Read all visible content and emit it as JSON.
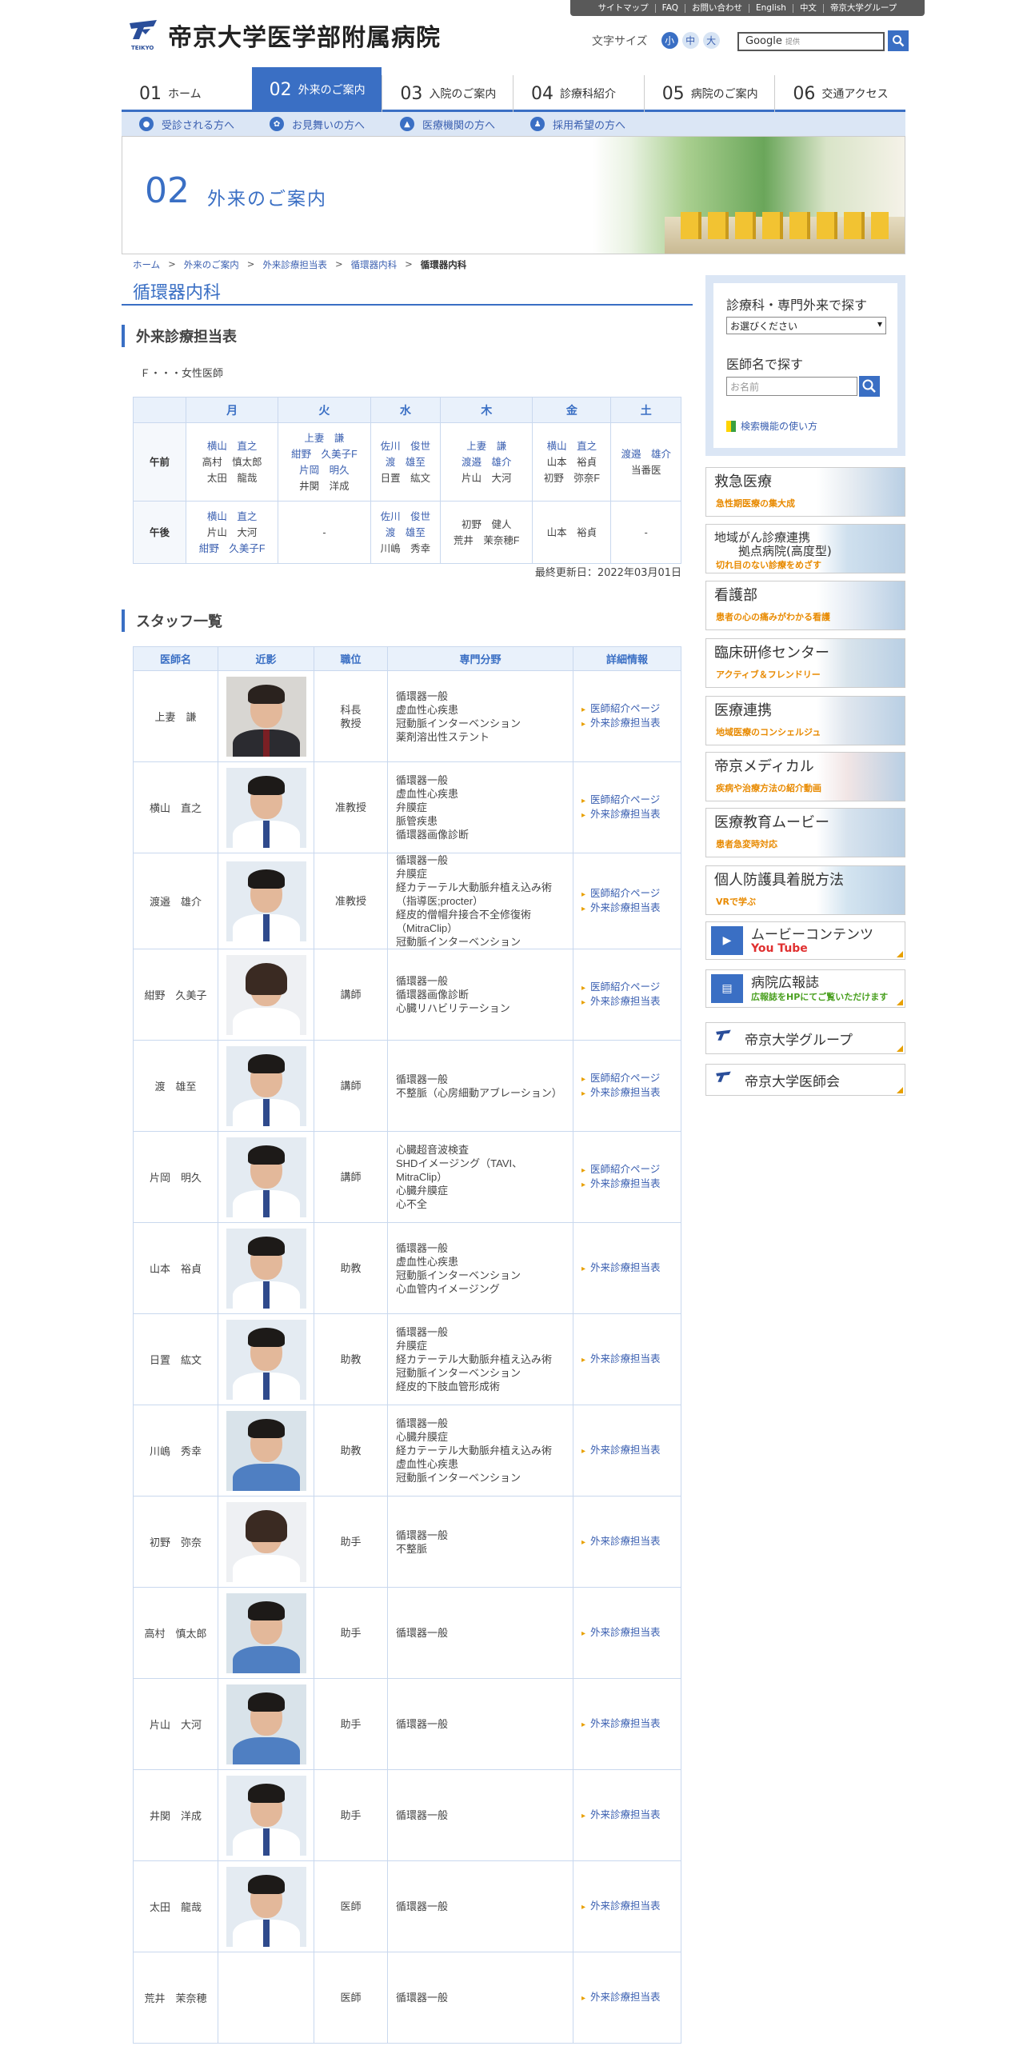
{
  "util_links": [
    "サイトマップ",
    "FAQ",
    "お問い合わせ",
    "English",
    "中文",
    "帝京大学グループ"
  ],
  "site_title": "帝京大学医学部附属病院",
  "logo_sub": "TEIKYO",
  "font_size": {
    "label": "文字サイズ",
    "small": "小",
    "medium": "中",
    "large": "大"
  },
  "search": {
    "brand": "Google",
    "sub": "提供"
  },
  "nav": [
    {
      "num": "01",
      "label": "ホーム"
    },
    {
      "num": "02",
      "label": "外来のご案内"
    },
    {
      "num": "03",
      "label": "入院のご案内"
    },
    {
      "num": "04",
      "label": "診療科紹介"
    },
    {
      "num": "05",
      "label": "病院のご案内"
    },
    {
      "num": "06",
      "label": "交通アクセス"
    }
  ],
  "subnav": [
    "受診される方へ",
    "お見舞いの方へ",
    "医療機関の方へ",
    "採用希望の方へ"
  ],
  "hero": {
    "num": "02",
    "title": "外来のご案内"
  },
  "breadcrumb": [
    "ホーム",
    "外来のご案内",
    "外来診療担当表",
    "循環器内科",
    "循環器内科"
  ],
  "page_title": "循環器内科",
  "schedule_heading": "外来診療担当表",
  "female_note": "Ｆ・・・女性医師",
  "schedule": {
    "days": [
      "月",
      "火",
      "水",
      "木",
      "金",
      "土"
    ],
    "am_label": "午前",
    "pm_label": "午後",
    "am": [
      [
        {
          "t": "横山　直之",
          "l": true
        },
        {
          "t": "高村　慎太郎",
          "l": false
        },
        {
          "t": "太田　龍哉",
          "l": false
        }
      ],
      [
        {
          "t": "上妻　謙",
          "l": true
        },
        {
          "t": "紺野　久美子F",
          "l": true
        },
        {
          "t": "片岡　明久",
          "l": true
        },
        {
          "t": "井関　洋成",
          "l": false
        }
      ],
      [
        {
          "t": "佐川　俊世",
          "l": true
        },
        {
          "t": "渡　雄至",
          "l": true
        },
        {
          "t": "日置　紘文",
          "l": false
        }
      ],
      [
        {
          "t": "上妻　謙",
          "l": true
        },
        {
          "t": "渡邉　雄介",
          "l": true
        },
        {
          "t": "片山　大河",
          "l": false
        }
      ],
      [
        {
          "t": "横山　直之",
          "l": true
        },
        {
          "t": "山本　裕貞",
          "l": false
        },
        {
          "t": "初野　弥奈F",
          "l": false
        }
      ],
      [
        {
          "t": "渡邉　雄介",
          "l": true
        },
        {
          "t": "当番医",
          "l": false
        }
      ]
    ],
    "pm": [
      [
        {
          "t": "横山　直之",
          "l": true
        },
        {
          "t": "片山　大河",
          "l": false
        },
        {
          "t": "紺野　久美子F",
          "l": true
        }
      ],
      [
        {
          "t": "-",
          "l": false
        }
      ],
      [
        {
          "t": "佐川　俊世",
          "l": true
        },
        {
          "t": "渡　雄至",
          "l": true
        },
        {
          "t": "川嶋　秀幸",
          "l": false
        }
      ],
      [
        {
          "t": "初野　健人",
          "l": false
        },
        {
          "t": "荒井　茉奈穂F",
          "l": false
        }
      ],
      [
        {
          "t": "山本　裕貞",
          "l": false
        }
      ],
      [
        {
          "t": "-",
          "l": false
        }
      ]
    ],
    "updated": "最終更新日：2022年03月01日"
  },
  "staff_heading": "スタッフ一覧",
  "staff_cols": [
    "医師名",
    "近影",
    "職位",
    "専門分野",
    "詳細情報"
  ],
  "link_profile": "医師紹介ページ",
  "link_schedule": "外来診療担当表",
  "staff": [
    {
      "name": "上妻　謙",
      "rank": "科長\n教授",
      "spec": "循環器一般\n虚血性心疾患\n冠動脈インターベンション\n薬剤溶出性ステント",
      "profile": true,
      "photo": "suit"
    },
    {
      "name": "横山　直之",
      "rank": "准教授",
      "spec": "循環器一般\n虚血性心疾患\n弁膜症\n脈管疾患\n循環器画像診断",
      "profile": true,
      "photo": "white"
    },
    {
      "name": "渡邉　雄介",
      "rank": "准教授",
      "spec": "循環器一般\n弁膜症\n経カテーテル大動脈弁植え込み術\n（指導医;procter）\n経皮的僧帽弁接合不全修復術\n（MitraClip）\n冠動脈インターベンション",
      "profile": true,
      "photo": "white"
    },
    {
      "name": "紺野　久美子",
      "rank": "講師",
      "spec": "循環器一般\n循環器画像診断\n心臓リハビリテーション",
      "profile": true,
      "photo": "female"
    },
    {
      "name": "渡　雄至",
      "rank": "講師",
      "spec": "循環器一般\n不整脈（心房細動アブレーション）",
      "profile": true,
      "photo": "white"
    },
    {
      "name": "片岡　明久",
      "rank": "講師",
      "spec": "心臓超音波検査\nSHDイメージング（TAVI、MitraClip）\n心臓弁膜症\n心不全",
      "profile": true,
      "photo": "white"
    },
    {
      "name": "山本　裕貞",
      "rank": "助教",
      "spec": "循環器一般\n虚血性心疾患\n冠動脈インターベンション\n心血管内イメージング",
      "profile": false,
      "photo": "white"
    },
    {
      "name": "日置　紘文",
      "rank": "助教",
      "spec": "循環器一般\n弁膜症\n経カテーテル大動脈弁植え込み術\n冠動脈インターベンション\n経皮的下肢血管形成術",
      "profile": false,
      "photo": "white"
    },
    {
      "name": "川嶋　秀幸",
      "rank": "助教",
      "spec": "循環器一般\n心臓弁膜症\n経カテーテル大動脈弁植え込み術\n虚血性心疾患\n冠動脈インターベンション",
      "profile": false,
      "photo": "scrub"
    },
    {
      "name": "初野　弥奈",
      "rank": "助手",
      "spec": "循環器一般\n不整脈",
      "profile": false,
      "photo": "female"
    },
    {
      "name": "高村　慎太郎",
      "rank": "助手",
      "spec": "循環器一般",
      "profile": false,
      "photo": "scrub"
    },
    {
      "name": "片山　大河",
      "rank": "助手",
      "spec": "循環器一般",
      "profile": false,
      "photo": "scrub"
    },
    {
      "name": "井関　洋成",
      "rank": "助手",
      "spec": "循環器一般",
      "profile": false,
      "photo": "white"
    },
    {
      "name": "太田　龍哉",
      "rank": "医師",
      "spec": "循環器一般",
      "profile": false,
      "photo": "white"
    },
    {
      "name": "荒井　茉奈穂",
      "rank": "医師",
      "spec": "循環器一般",
      "profile": false,
      "photo": "none"
    }
  ],
  "sidebar": {
    "dept_heading": "診療科・専門外来で探す",
    "dept_select": "お選びください",
    "doctor_heading": "医師名で探す",
    "doctor_placeholder": "お名前",
    "howto": "検索機能の使い方",
    "banners": [
      {
        "title": "救急医療",
        "sub": "急性期医療の集大成"
      },
      {
        "title": "地域がん診療連携\n　　拠点病院(高度型)",
        "sub": "切れ目のない診療をめざす"
      },
      {
        "title": "看護部",
        "sub": "患者の心の痛みがわかる看護"
      },
      {
        "title": "臨床研修センター",
        "sub": "アクティブ＆フレンドリー"
      },
      {
        "title": "医療連携",
        "sub": "地域医療のコンシェルジュ"
      },
      {
        "title": "帝京メディカル",
        "sub": "疾病や治療方法の紹介動画"
      },
      {
        "title": "医療教育ムービー",
        "sub": "患者急変時対応"
      },
      {
        "title": "個人防護具着脱方法",
        "sub": "VRで学ぶ"
      }
    ],
    "movie": {
      "title": "ムービーコンテンツ",
      "sub": "You Tube"
    },
    "pr": {
      "title": "病院広報誌",
      "sub": "広報誌をHPにてご覧いただけます"
    },
    "group": "帝京大学グループ",
    "alumni": "帝京大学医師会"
  }
}
